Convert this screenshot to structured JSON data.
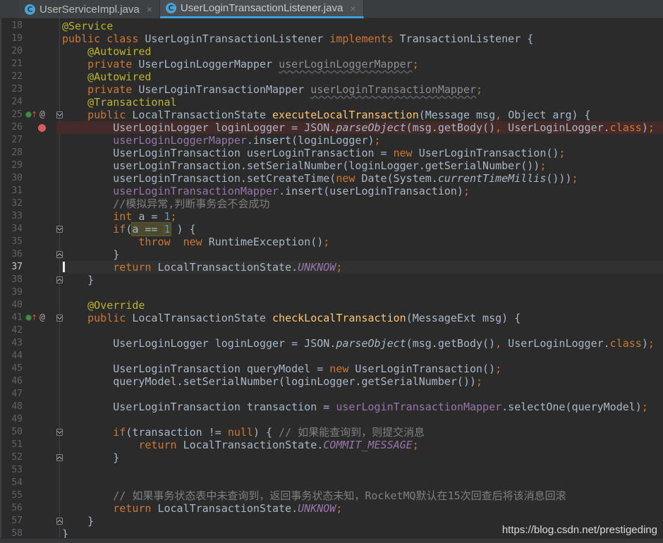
{
  "ui": {
    "close_glyph": "×",
    "class_icon_letter": "C",
    "at_glyph": "@"
  },
  "colors": {
    "editor_bg": "#2B2B2B",
    "tabbar_bg": "#3A3D3F",
    "active_tab_underline": "#3C9EDB",
    "keyword": "#CC7832",
    "annotation": "#BBB529",
    "default_text": "#A9B7C6",
    "method_decl": "#FFC66D",
    "field": "#9876AA",
    "number": "#6897BB",
    "comment": "#808080",
    "breakpoint_dot": "#DB5C5C",
    "breakpoint_row_bg": "#452A2A",
    "selection_highlight": "#4B4A2F",
    "line_number": "#606366"
  },
  "tabs": [
    {
      "label": "UserServiceImpl.java",
      "active": false
    },
    {
      "label": "UserLoginTransactionListener.java",
      "active": true
    }
  ],
  "watermark": "https://blog.csdn.net/prestigeding",
  "editor": {
    "lines": [
      {
        "n": 18,
        "ind": 0,
        "t": [
          [
            "ann",
            "@Service"
          ]
        ]
      },
      {
        "n": 19,
        "ind": 0,
        "t": [
          [
            "kw",
            "public class "
          ],
          [
            "def",
            "UserLoginTransactionListener "
          ],
          [
            "kw",
            "implements "
          ],
          [
            "def",
            "TransactionListener {"
          ]
        ]
      },
      {
        "n": 20,
        "ind": 4,
        "t": [
          [
            "ann",
            "@Autowired"
          ]
        ]
      },
      {
        "n": 21,
        "ind": 4,
        "t": [
          [
            "kw",
            "private "
          ],
          [
            "def",
            "UserLoginLoggerMapper "
          ],
          [
            "fldu",
            "userLoginLoggerMapper"
          ],
          [
            "kw",
            ";"
          ]
        ]
      },
      {
        "n": 22,
        "ind": 4,
        "t": [
          [
            "ann",
            "@Autowired"
          ]
        ]
      },
      {
        "n": 23,
        "ind": 4,
        "t": [
          [
            "kw",
            "private "
          ],
          [
            "def",
            "UserLoginTransactionMapper "
          ],
          [
            "fldu",
            "userLoginTransactionMapper"
          ],
          [
            "kw",
            ";"
          ]
        ]
      },
      {
        "n": 24,
        "ind": 4,
        "t": [
          [
            "ann",
            "@Transactional"
          ]
        ]
      },
      {
        "n": 25,
        "ind": 4,
        "ovr": true,
        "fold": "down",
        "t": [
          [
            "kw",
            "public "
          ],
          [
            "def",
            "LocalTransactionState "
          ],
          [
            "mth",
            "executeLocalTransaction"
          ],
          [
            "def",
            "(Message msg"
          ],
          [
            "kw",
            ", "
          ],
          [
            "def",
            "Object arg) {"
          ]
        ]
      },
      {
        "n": 26,
        "ind": 8,
        "bp": true,
        "t": [
          [
            "def",
            "UserLoginLogger loginLogger = JSON."
          ],
          [
            "stat",
            "parseObject"
          ],
          [
            "def",
            "(msg.getBody()"
          ],
          [
            "kw",
            ", "
          ],
          [
            "def",
            "UserLoginLogger."
          ],
          [
            "kw",
            "class"
          ],
          [
            "def",
            ")"
          ],
          [
            "kw",
            ";"
          ]
        ]
      },
      {
        "n": 27,
        "ind": 8,
        "t": [
          [
            "fld",
            "userLoginLoggerMapper"
          ],
          [
            "def",
            ".insert(loginLogger)"
          ],
          [
            "kw",
            ";"
          ]
        ]
      },
      {
        "n": 28,
        "ind": 8,
        "t": [
          [
            "def",
            "UserLoginTransaction userLoginTransaction = "
          ],
          [
            "kw",
            "new "
          ],
          [
            "def",
            "UserLoginTransaction()"
          ],
          [
            "kw",
            ";"
          ]
        ]
      },
      {
        "n": 29,
        "ind": 8,
        "t": [
          [
            "def",
            "userLoginTransaction.setSerialNumber(loginLogger.getSerialNumber())"
          ],
          [
            "kw",
            ";"
          ]
        ]
      },
      {
        "n": 30,
        "ind": 8,
        "t": [
          [
            "def",
            "userLoginTransaction.setCreateTime("
          ],
          [
            "kw",
            "new "
          ],
          [
            "def",
            "Date(System."
          ],
          [
            "stat",
            "currentTimeMillis"
          ],
          [
            "def",
            "()))"
          ],
          [
            "kw",
            ";"
          ]
        ]
      },
      {
        "n": 31,
        "ind": 8,
        "t": [
          [
            "fld",
            "userLoginTransactionMapper"
          ],
          [
            "def",
            ".insert(userLoginTransaction)"
          ],
          [
            "kw",
            ";"
          ]
        ]
      },
      {
        "n": 32,
        "ind": 8,
        "t": [
          [
            "cmt",
            "//模拟异常,判断事务会不会成功"
          ]
        ]
      },
      {
        "n": 33,
        "ind": 8,
        "t": [
          [
            "kw",
            "int "
          ],
          [
            "def",
            "a = "
          ],
          [
            "num",
            "1"
          ],
          [
            "kw",
            ";"
          ]
        ]
      },
      {
        "n": 34,
        "ind": 8,
        "fold": "down",
        "t": [
          [
            "kw",
            "if"
          ],
          [
            "def",
            "("
          ],
          [
            "def",
            "a == ",
            "hl"
          ],
          [
            "num",
            "1",
            "hl"
          ],
          [
            "def",
            " ) {"
          ]
        ]
      },
      {
        "n": 35,
        "ind": 12,
        "t": [
          [
            "kw",
            "throw  new "
          ],
          [
            "def",
            "RuntimeException()"
          ],
          [
            "kw",
            ";"
          ]
        ]
      },
      {
        "n": 36,
        "ind": 8,
        "fold": "up",
        "t": [
          [
            "def",
            "}"
          ]
        ]
      },
      {
        "n": 37,
        "ind": 8,
        "cur": true,
        "caret": true,
        "t": [
          [
            "kw",
            "return "
          ],
          [
            "def",
            "LocalTransactionState."
          ],
          [
            "enumc",
            "UNKNOW"
          ],
          [
            "kw",
            ";"
          ]
        ]
      },
      {
        "n": 38,
        "ind": 4,
        "fold": "up",
        "t": [
          [
            "def",
            "}"
          ]
        ]
      },
      {
        "n": 39,
        "ind": 0,
        "t": []
      },
      {
        "n": 40,
        "ind": 4,
        "t": [
          [
            "ann",
            "@Override"
          ]
        ]
      },
      {
        "n": 41,
        "ind": 4,
        "ovr": true,
        "fold": "down",
        "t": [
          [
            "kw",
            "public "
          ],
          [
            "def",
            "LocalTransactionState "
          ],
          [
            "mth",
            "checkLocalTransaction"
          ],
          [
            "def",
            "(MessageExt msg) {"
          ]
        ]
      },
      {
        "n": 42,
        "ind": 0,
        "t": []
      },
      {
        "n": 43,
        "ind": 8,
        "t": [
          [
            "def",
            "UserLoginLogger loginLogger = JSON."
          ],
          [
            "stat",
            "parseObject"
          ],
          [
            "def",
            "(msg.getBody()"
          ],
          [
            "kw",
            ", "
          ],
          [
            "def",
            "UserLoginLogger."
          ],
          [
            "kw",
            "class"
          ],
          [
            "def",
            ")"
          ],
          [
            "kw",
            ";"
          ]
        ]
      },
      {
        "n": 44,
        "ind": 0,
        "t": []
      },
      {
        "n": 45,
        "ind": 8,
        "t": [
          [
            "def",
            "UserLoginTransaction queryModel = "
          ],
          [
            "kw",
            "new "
          ],
          [
            "def",
            "UserLoginTransaction()"
          ],
          [
            "kw",
            ";"
          ]
        ]
      },
      {
        "n": 46,
        "ind": 8,
        "t": [
          [
            "def",
            "queryModel.setSerialNumber(loginLogger.getSerialNumber())"
          ],
          [
            "kw",
            ";"
          ]
        ]
      },
      {
        "n": 47,
        "ind": 0,
        "t": []
      },
      {
        "n": 48,
        "ind": 8,
        "t": [
          [
            "def",
            "UserLoginTransaction transaction = "
          ],
          [
            "fld",
            "userLoginTransactionMapper"
          ],
          [
            "def",
            ".selectOne(queryModel)"
          ],
          [
            "kw",
            ";"
          ]
        ]
      },
      {
        "n": 49,
        "ind": 0,
        "t": []
      },
      {
        "n": 50,
        "ind": 8,
        "fold": "down",
        "t": [
          [
            "kw",
            "if"
          ],
          [
            "def",
            "(transaction != "
          ],
          [
            "kw",
            "null"
          ],
          [
            "def",
            ") { "
          ],
          [
            "cmt",
            "// 如果能查询到，则提交消息"
          ]
        ]
      },
      {
        "n": 51,
        "ind": 12,
        "t": [
          [
            "kw",
            "return "
          ],
          [
            "def",
            "LocalTransactionState."
          ],
          [
            "enumc",
            "COMMIT_MESSAGE"
          ],
          [
            "kw",
            ";"
          ]
        ]
      },
      {
        "n": 52,
        "ind": 8,
        "fold": "up",
        "t": [
          [
            "def",
            "}"
          ]
        ]
      },
      {
        "n": 53,
        "ind": 0,
        "t": []
      },
      {
        "n": 54,
        "ind": 0,
        "t": []
      },
      {
        "n": 55,
        "ind": 8,
        "t": [
          [
            "cmt",
            "// 如果事务状态表中未查询到，返回事务状态未知，RocketMQ默认在15次回查后将该消息回滚"
          ]
        ]
      },
      {
        "n": 56,
        "ind": 8,
        "t": [
          [
            "kw",
            "return "
          ],
          [
            "def",
            "LocalTransactionState."
          ],
          [
            "enumc",
            "UNKNOW"
          ],
          [
            "kw",
            ";"
          ]
        ]
      },
      {
        "n": 57,
        "ind": 4,
        "fold": "up",
        "t": [
          [
            "def",
            "}"
          ]
        ]
      },
      {
        "n": 58,
        "ind": 0,
        "t": [
          [
            "def",
            "}"
          ]
        ]
      }
    ]
  }
}
